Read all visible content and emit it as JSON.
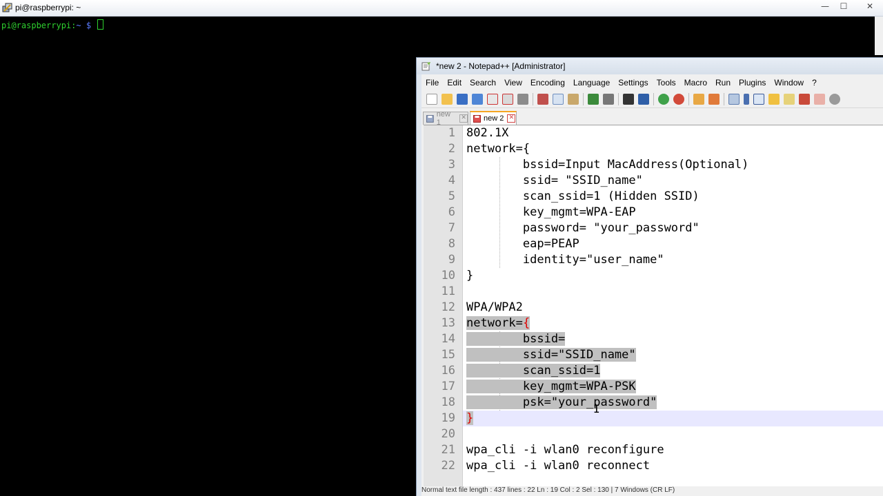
{
  "terminal": {
    "title": "pi@raspberrypi: ~",
    "prompt_user": "pi@raspberrypi",
    "prompt_sep": ":",
    "prompt_path": "~",
    "prompt_symbol": "$",
    "colors": {
      "user": "#2fd12f",
      "path": "#5b7cff"
    },
    "window_buttons": {
      "minimize": "—",
      "maximize": "☐",
      "close": "✕"
    }
  },
  "notepad": {
    "title": "*new 2 - Notepad++ [Administrator]",
    "menu": [
      "File",
      "Edit",
      "Search",
      "View",
      "Encoding",
      "Language",
      "Settings",
      "Tools",
      "Macro",
      "Run",
      "Plugins",
      "Window",
      "?"
    ],
    "tabs": [
      {
        "label": "new 1",
        "active": false
      },
      {
        "label": "new 2",
        "active": true
      }
    ],
    "lines": [
      {
        "n": "1",
        "text": "802.1X"
      },
      {
        "n": "2",
        "text": "network={"
      },
      {
        "n": "3",
        "text": "        bssid=Input MacAddress(Optional)"
      },
      {
        "n": "4",
        "text": "        ssid= \"SSID_name\""
      },
      {
        "n": "5",
        "text": "        scan_ssid=1 (Hidden SSID)"
      },
      {
        "n": "6",
        "text": "        key_mgmt=WPA-EAP"
      },
      {
        "n": "7",
        "text": "        password= \"your_password\""
      },
      {
        "n": "8",
        "text": "        eap=PEAP"
      },
      {
        "n": "9",
        "text": "        identity=\"user_name\""
      },
      {
        "n": "10",
        "text": "}"
      },
      {
        "n": "11",
        "text": ""
      },
      {
        "n": "12",
        "text": "WPA/WPA2"
      },
      {
        "n": "13",
        "text": "network={"
      },
      {
        "n": "14",
        "text": "        bssid="
      },
      {
        "n": "15",
        "text": "        ssid=\"SSID_name\""
      },
      {
        "n": "16",
        "text": "        scan_ssid=1"
      },
      {
        "n": "17",
        "text": "        key_mgmt=WPA-PSK"
      },
      {
        "n": "18",
        "text": "        psk=\"your_password\""
      },
      {
        "n": "19",
        "text": "}"
      },
      {
        "n": "20",
        "text": ""
      },
      {
        "n": "21",
        "text": "wpa_cli -i wlan0 reconfigure"
      },
      {
        "n": "22",
        "text": "wpa_cli -i wlan0 reconnect"
      }
    ],
    "status": "Normal text file    length : 437    lines : 22        Ln : 19    Col : 2    Sel : 130 | 7                    Windows (CR LF)",
    "colors": {
      "selection": "#c0c0c0",
      "brace": "#e00000",
      "current_line": "#e8e8ff",
      "tab_accent": "#f5a623"
    }
  }
}
